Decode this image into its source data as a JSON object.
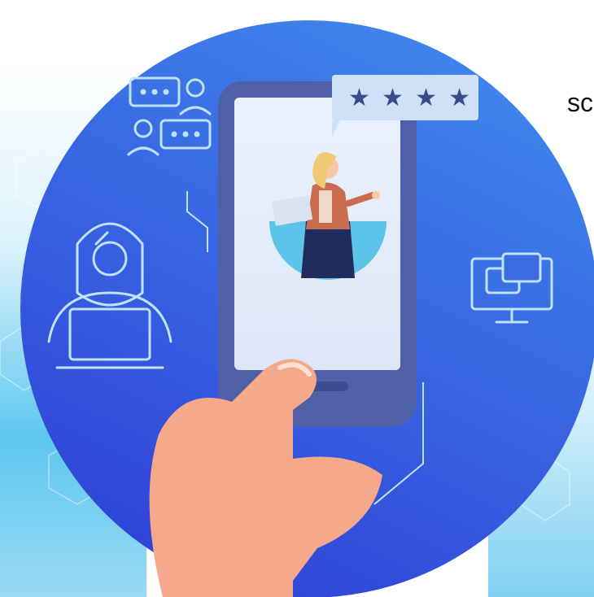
{
  "illustration": {
    "description_text_cropped_top": "",
    "side_text": "sc",
    "rating": {
      "stars": 4,
      "star_glyph": "★"
    }
  },
  "colors": {
    "circle_top": "#3f86ec",
    "circle_bottom": "#2f3fd6",
    "phone_body": "#4f5fa8",
    "phone_screen": "#e6eefb",
    "bubble": "#cfe1f6",
    "star": "#3a4a8a",
    "hand": "#f5a98a",
    "icon_stroke": "#bfe2ff",
    "bg_cyan": "#3fbde9"
  },
  "icons": [
    "chat-people-icon",
    "user-laptop-icon",
    "monitor-chat-icon",
    "rating-bubble-icon"
  ]
}
